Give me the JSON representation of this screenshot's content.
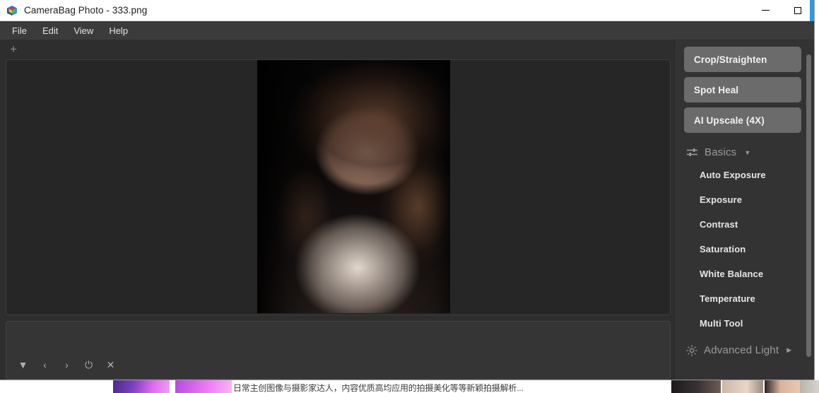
{
  "window": {
    "title": "CameraBag Photo - 333.png",
    "app_icon": "prism-cube-icon",
    "controls": {
      "minimize": "minimize-icon",
      "maximize": "maximize-icon"
    },
    "accent_blue": "#2f9ae0"
  },
  "menubar": {
    "items": [
      {
        "label": "File"
      },
      {
        "label": "Edit"
      },
      {
        "label": "View"
      },
      {
        "label": "Help"
      }
    ]
  },
  "tabbar": {
    "add_tab_label": "+"
  },
  "canvas": {
    "photo_alt": "portrait-photo-woman-dark-background"
  },
  "bottom_toolbar": {
    "items": [
      {
        "name": "dropdown-triangle-icon",
        "glyph": "▼"
      },
      {
        "name": "previous-icon",
        "glyph": "‹"
      },
      {
        "name": "next-icon",
        "glyph": "›"
      },
      {
        "name": "power-icon",
        "glyph": "⏻"
      },
      {
        "name": "close-icon",
        "glyph": "✕"
      }
    ]
  },
  "right_panel": {
    "buttons": [
      {
        "label": "Crop/Straighten"
      },
      {
        "label": "Spot Heal"
      },
      {
        "label": "AI Upscale (4X)"
      }
    ],
    "sections": [
      {
        "label": "Basics",
        "icon": "sliders-icon",
        "caret": "▼",
        "expanded": true,
        "items": [
          {
            "label": "Auto Exposure"
          },
          {
            "label": "Exposure"
          },
          {
            "label": "Contrast"
          },
          {
            "label": "Saturation"
          },
          {
            "label": "White Balance"
          },
          {
            "label": "Temperature"
          },
          {
            "label": "Multi Tool"
          }
        ]
      },
      {
        "label": "Advanced Light",
        "icon": "sun-icon",
        "caret": "▶",
        "expanded": false,
        "items": []
      }
    ]
  },
  "desktop_background": {
    "caption_text": "日常主创图像与摄影家达人，内容优质高均应用的拍摄美化等等新颖拍摄解析..."
  }
}
